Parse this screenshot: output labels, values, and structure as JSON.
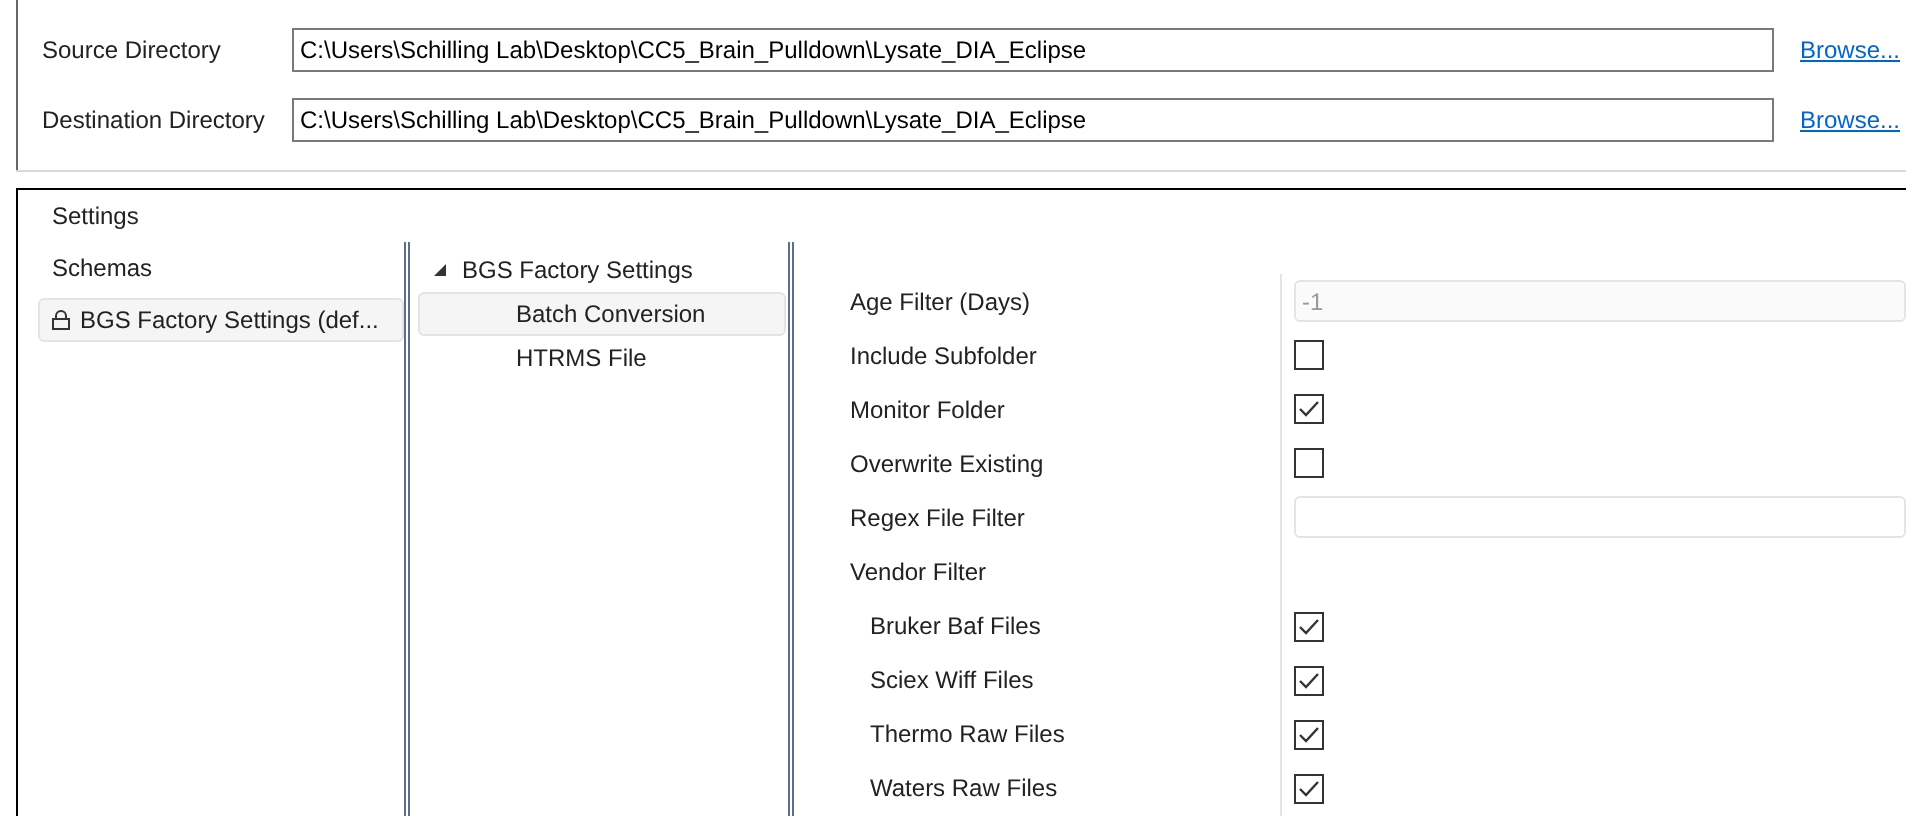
{
  "directories": [
    {
      "label": "Source Directory",
      "value": "C:\\Users\\Schilling Lab\\Desktop\\CC5_Brain_Pulldown\\Lysate_DIA_Eclipse",
      "link": "Browse..."
    },
    {
      "label": "Destination Directory",
      "value": "C:\\Users\\Schilling Lab\\Desktop\\CC5_Brain_Pulldown\\Lysate_DIA_Eclipse",
      "link": "Browse..."
    }
  ],
  "settings": {
    "title": "Settings",
    "schemas": {
      "header": "Schemas",
      "items": [
        {
          "label": "BGS Factory Settings (def...",
          "locked": true,
          "selected": true
        }
      ]
    },
    "tree": [
      {
        "label": "BGS Factory Settings",
        "expanded": true,
        "children": [
          {
            "label": "Batch Conversion",
            "selected": true
          },
          {
            "label": "HTRMS File",
            "selected": false
          }
        ]
      }
    ],
    "properties": [
      {
        "kind": "text",
        "label": "Age Filter (Days)",
        "value": "-1",
        "disabled": true
      },
      {
        "kind": "checkbox",
        "label": "Include Subfolder",
        "checked": false
      },
      {
        "kind": "checkbox",
        "label": "Monitor Folder",
        "checked": true
      },
      {
        "kind": "checkbox",
        "label": "Overwrite Existing",
        "checked": false
      },
      {
        "kind": "text",
        "label": "Regex File Filter"
      },
      {
        "kind": "group",
        "label": "Vendor Filter",
        "children": [
          {
            "kind": "checkbox",
            "label": "Bruker Baf Files",
            "checked": true
          },
          {
            "kind": "checkbox",
            "label": "Sciex Wiff Files",
            "checked": true
          },
          {
            "kind": "checkbox",
            "label": "Thermo Raw Files",
            "checked": true
          },
          {
            "kind": "checkbox",
            "label": "Waters Raw Files",
            "checked": true
          }
        ]
      }
    ]
  }
}
